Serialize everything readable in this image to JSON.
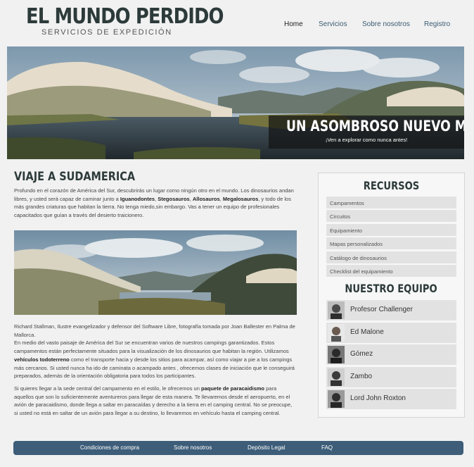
{
  "header": {
    "logo_title": "EL MUNDO PERDIDO",
    "logo_subtitle": "SERVICIOS DE EXPEDICIÓN"
  },
  "nav": {
    "items": [
      {
        "label": "Home",
        "active": true
      },
      {
        "label": "Servicios",
        "active": false
      },
      {
        "label": "Sobre nosotros",
        "active": false
      },
      {
        "label": "Registro",
        "active": false
      }
    ]
  },
  "hero": {
    "title": "UN ASOMBROSO NUEVO MUNDO",
    "subtitle": "¡Ven a explorar como nunca antes!"
  },
  "main": {
    "heading": "VIAJE A SUDAMERICA",
    "intro_parts": [
      "Profundo en el corazón de América del Sur, descubrirás un lugar como ningún otro en el mundo. Los dinosaurios andan libres, y usted será capaz de caminar junto a ",
      "Iguanodontes",
      ", ",
      "Stegosauros",
      ", ",
      "Allosauros",
      ", ",
      "Megalosauros",
      ", y todo de los más grandes criaturas que habitan la tierra. No tenga miedo,sin embargo. Vas a tener un equipo de profesionales capacitados que guían a través del desierto traicionero."
    ],
    "caption_parts": [
      "Richard Stallman, Ilustre evangelizador y defensor del Software Libre, fotografía tomada por Joan Ballester en Palma de Mallorca.",
      "En medio del vasto paisaje de América del Sur se encuentran varios de nuestros campings garantizados. Estos campamentos están perfectamente situados para la visualización de los dinosaurios que habitan la región. Utilizamos ",
      "vehículos todoterreno",
      " como el transporte hacia y desde los sitios para acampar, así como viajar a pie a los campings más cercanos. Si usted nunca ha ido de caminata o acampado antes , ofrecemos clases de iniciación que le conseguirá preparados, además de la orientación obligatoria para todos los participantes."
    ],
    "para3_parts": [
      "Si quieres llegar a la sede central del campamento en el estilo, le ofrecemos un ",
      "paquete de paracaidismo",
      " para aquellos que son lo suficientemente aventureros para llegar de esta manera. Te llevaremos desde el aeropuerto, en el avión de paracaidismo, donde llega a saltar en paracaídas y derecho a la tierra en el camping central. No se preocupe, si usted no está en saltar de un avión para llegar a su destino, lo llevaremos en vehículo hasta el camping central."
    ]
  },
  "aside": {
    "resources_title": "RECURSOS",
    "resources": [
      "Campamentos",
      "Circuitos",
      "Equipamiento",
      "Mapas personalizados",
      "Catálogo de dinosaurios",
      "Checklist del equipamiento"
    ],
    "team_title": "NUESTRO EQUIPO",
    "team": [
      {
        "name": "Profesor Challenger",
        "avatar": "person-avatar"
      },
      {
        "name": "Ed Malone",
        "avatar": "person-avatar"
      },
      {
        "name": "Gómez",
        "avatar": "person-avatar"
      },
      {
        "name": "Zambo",
        "avatar": "person-avatar"
      },
      {
        "name": "Lord John Roxton",
        "avatar": "person-avatar"
      }
    ]
  },
  "footer": {
    "links": [
      "Condiciones de compra",
      "Sobre nosotros",
      "Depósito Legal",
      "FAQ"
    ]
  },
  "colors": {
    "background": "#f1f1f1",
    "heading": "#2d3a3a",
    "nav_link": "#3b5b72",
    "footer_bar": "#3d5d79",
    "aside_item": "#e2e2e2"
  }
}
